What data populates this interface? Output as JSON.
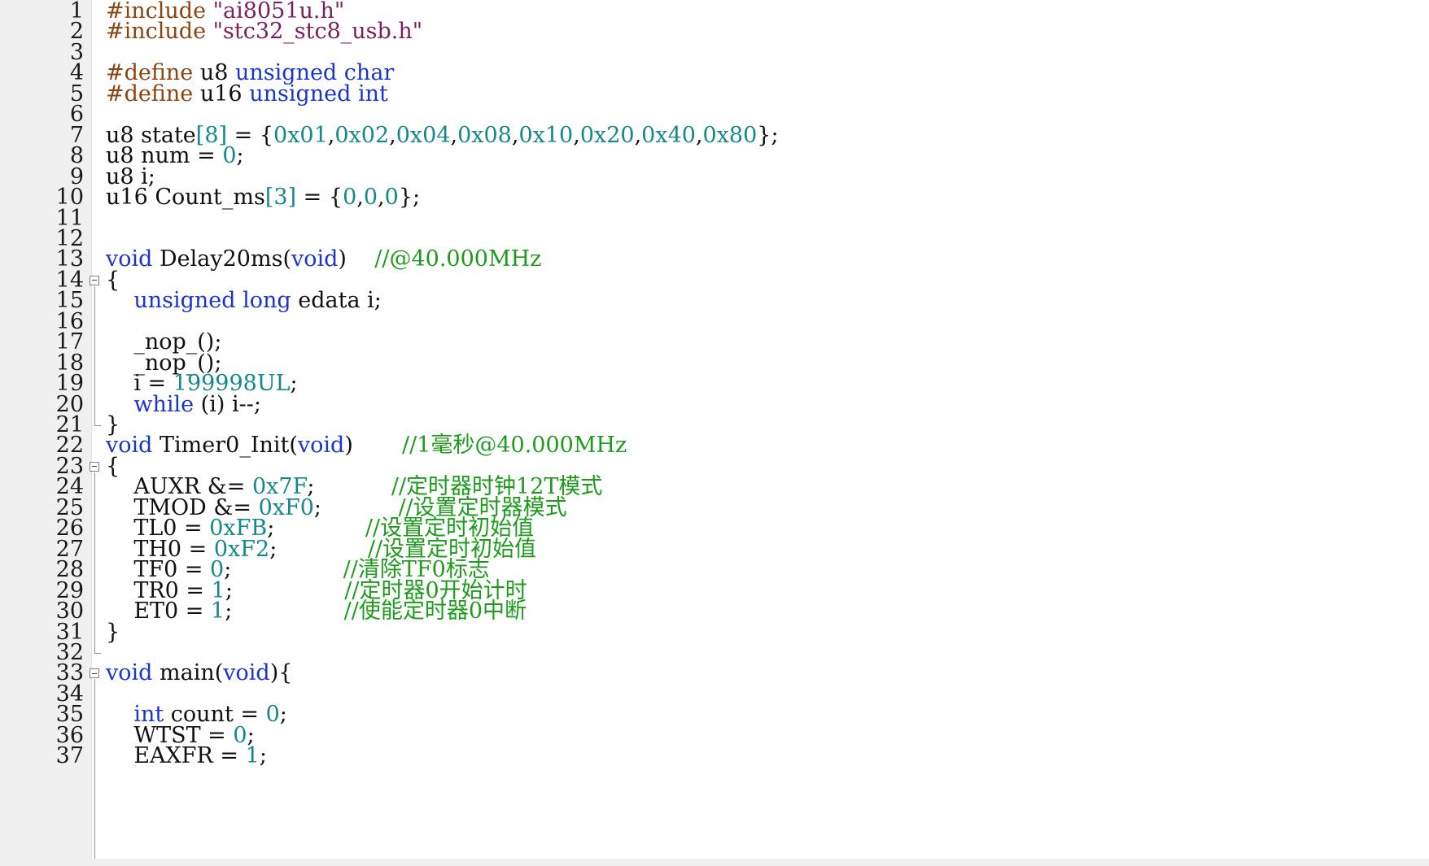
{
  "editor": {
    "colors": {
      "preprocessor": "#8b4513",
      "string": "#7a1f5a",
      "keyword": "#1d34c9",
      "number": "#16888a",
      "comment": "#1f9a1f",
      "text": "#111111",
      "gutter": "#f0f0f0"
    },
    "lines": [
      {
        "n": "1",
        "fold": "",
        "tokens": [
          {
            "t": "#include ",
            "c": "p"
          },
          {
            "t": "\"ai8051u.h\"",
            "c": "s"
          }
        ]
      },
      {
        "n": "2",
        "fold": "",
        "tokens": [
          {
            "t": "#include ",
            "c": "p"
          },
          {
            "t": "\"stc32_stc8_usb.h\"",
            "c": "s"
          }
        ]
      },
      {
        "n": "3",
        "fold": "",
        "tokens": []
      },
      {
        "n": "4",
        "fold": "",
        "tokens": [
          {
            "t": "#define ",
            "c": "p"
          },
          {
            "t": "u8 ",
            "c": "t"
          },
          {
            "t": "unsigned char",
            "c": "k"
          }
        ]
      },
      {
        "n": "5",
        "fold": "",
        "tokens": [
          {
            "t": "#define ",
            "c": "p"
          },
          {
            "t": "u16 ",
            "c": "t"
          },
          {
            "t": "unsigned int",
            "c": "k"
          }
        ]
      },
      {
        "n": "6",
        "fold": "",
        "tokens": []
      },
      {
        "n": "7",
        "fold": "",
        "tokens": [
          {
            "t": "u8 state",
            "c": "t"
          },
          {
            "t": "[8]",
            "c": "n"
          },
          {
            "t": " = {",
            "c": "t"
          },
          {
            "t": "0x01",
            "c": "n"
          },
          {
            "t": ",",
            "c": "t"
          },
          {
            "t": "0x02",
            "c": "n"
          },
          {
            "t": ",",
            "c": "t"
          },
          {
            "t": "0x04",
            "c": "n"
          },
          {
            "t": ",",
            "c": "t"
          },
          {
            "t": "0x08",
            "c": "n"
          },
          {
            "t": ",",
            "c": "t"
          },
          {
            "t": "0x10",
            "c": "n"
          },
          {
            "t": ",",
            "c": "t"
          },
          {
            "t": "0x20",
            "c": "n"
          },
          {
            "t": ",",
            "c": "t"
          },
          {
            "t": "0x40",
            "c": "n"
          },
          {
            "t": ",",
            "c": "t"
          },
          {
            "t": "0x80",
            "c": "n"
          },
          {
            "t": "};",
            "c": "t"
          }
        ]
      },
      {
        "n": "8",
        "fold": "",
        "tokens": [
          {
            "t": "u8 num = ",
            "c": "t"
          },
          {
            "t": "0",
            "c": "n"
          },
          {
            "t": ";",
            "c": "t"
          }
        ]
      },
      {
        "n": "9",
        "fold": "",
        "tokens": [
          {
            "t": "u8 i;",
            "c": "t"
          }
        ]
      },
      {
        "n": "10",
        "fold": "",
        "tokens": [
          {
            "t": "u16 Count_ms",
            "c": "t"
          },
          {
            "t": "[3]",
            "c": "n"
          },
          {
            "t": " = {",
            "c": "t"
          },
          {
            "t": "0",
            "c": "n"
          },
          {
            "t": ",",
            "c": "t"
          },
          {
            "t": "0",
            "c": "n"
          },
          {
            "t": ",",
            "c": "t"
          },
          {
            "t": "0",
            "c": "n"
          },
          {
            "t": "};",
            "c": "t"
          }
        ]
      },
      {
        "n": "11",
        "fold": "",
        "tokens": []
      },
      {
        "n": "12",
        "fold": "",
        "tokens": []
      },
      {
        "n": "13",
        "fold": "",
        "tokens": [
          {
            "t": "void",
            "c": "k"
          },
          {
            "t": " Delay20ms(",
            "c": "t"
          },
          {
            "t": "void",
            "c": "k"
          },
          {
            "t": ")    ",
            "c": "t"
          },
          {
            "t": "//@40.000MHz",
            "c": "c"
          }
        ]
      },
      {
        "n": "14",
        "fold": "open",
        "tokens": [
          {
            "t": "{",
            "c": "t"
          }
        ]
      },
      {
        "n": "15",
        "fold": "",
        "tokens": [
          {
            "t": "    ",
            "c": "t"
          },
          {
            "t": "unsigned long",
            "c": "k"
          },
          {
            "t": " edata i;",
            "c": "t"
          }
        ]
      },
      {
        "n": "16",
        "fold": "",
        "tokens": []
      },
      {
        "n": "17",
        "fold": "",
        "tokens": [
          {
            "t": "    _nop_();",
            "c": "t"
          }
        ]
      },
      {
        "n": "18",
        "fold": "",
        "tokens": [
          {
            "t": "    _nop_();",
            "c": "t"
          }
        ]
      },
      {
        "n": "19",
        "fold": "",
        "tokens": [
          {
            "t": "    i = ",
            "c": "t"
          },
          {
            "t": "199998UL",
            "c": "n"
          },
          {
            "t": ";",
            "c": "t"
          }
        ]
      },
      {
        "n": "20",
        "fold": "",
        "tokens": [
          {
            "t": "    ",
            "c": "t"
          },
          {
            "t": "while",
            "c": "k"
          },
          {
            "t": " (i) i--;",
            "c": "t"
          }
        ]
      },
      {
        "n": "21",
        "fold": "end",
        "tokens": [
          {
            "t": "}",
            "c": "t"
          }
        ]
      },
      {
        "n": "22",
        "fold": "",
        "tokens": [
          {
            "t": "void",
            "c": "k"
          },
          {
            "t": " Timer0_Init(",
            "c": "t"
          },
          {
            "t": "void",
            "c": "k"
          },
          {
            "t": ")       ",
            "c": "t"
          },
          {
            "t": "//1毫秒@40.000MHz",
            "c": "c"
          }
        ]
      },
      {
        "n": "23",
        "fold": "open",
        "tokens": [
          {
            "t": "{",
            "c": "t"
          }
        ]
      },
      {
        "n": "24",
        "fold": "",
        "tokens": [
          {
            "t": "    AUXR &= ",
            "c": "t"
          },
          {
            "t": "0x7F",
            "c": "n"
          },
          {
            "t": ";           ",
            "c": "t"
          },
          {
            "t": "//定时器时钟12T模式",
            "c": "c"
          }
        ]
      },
      {
        "n": "25",
        "fold": "",
        "tokens": [
          {
            "t": "    TMOD &= ",
            "c": "t"
          },
          {
            "t": "0xF0",
            "c": "n"
          },
          {
            "t": ";           ",
            "c": "t"
          },
          {
            "t": "//设置定时器模式",
            "c": "c"
          }
        ]
      },
      {
        "n": "26",
        "fold": "",
        "tokens": [
          {
            "t": "    TL0 = ",
            "c": "t"
          },
          {
            "t": "0xFB",
            "c": "n"
          },
          {
            "t": ";             ",
            "c": "t"
          },
          {
            "t": "//设置定时初始值",
            "c": "c"
          }
        ]
      },
      {
        "n": "27",
        "fold": "",
        "tokens": [
          {
            "t": "    TH0 = ",
            "c": "t"
          },
          {
            "t": "0xF2",
            "c": "n"
          },
          {
            "t": ";             ",
            "c": "t"
          },
          {
            "t": "//设置定时初始值",
            "c": "c"
          }
        ]
      },
      {
        "n": "28",
        "fold": "",
        "tokens": [
          {
            "t": "    TF0 = ",
            "c": "t"
          },
          {
            "t": "0",
            "c": "n"
          },
          {
            "t": ";                ",
            "c": "t"
          },
          {
            "t": "//清除TF0标志",
            "c": "c"
          }
        ]
      },
      {
        "n": "29",
        "fold": "",
        "tokens": [
          {
            "t": "    TR0 = ",
            "c": "t"
          },
          {
            "t": "1",
            "c": "n"
          },
          {
            "t": ";                ",
            "c": "t"
          },
          {
            "t": "//定时器0开始计时",
            "c": "c"
          }
        ]
      },
      {
        "n": "30",
        "fold": "",
        "tokens": [
          {
            "t": "    ET0 = ",
            "c": "t"
          },
          {
            "t": "1",
            "c": "n"
          },
          {
            "t": ";                ",
            "c": "t"
          },
          {
            "t": "//使能定时器0中断",
            "c": "c"
          }
        ]
      },
      {
        "n": "31",
        "fold": "",
        "tokens": [
          {
            "t": "}",
            "c": "t"
          }
        ]
      },
      {
        "n": "32",
        "fold": "end",
        "tokens": []
      },
      {
        "n": "33",
        "fold": "open",
        "tokens": [
          {
            "t": "void",
            "c": "k"
          },
          {
            "t": " main(",
            "c": "t"
          },
          {
            "t": "void",
            "c": "k"
          },
          {
            "t": "){",
            "c": "t"
          }
        ]
      },
      {
        "n": "34",
        "fold": "",
        "tokens": []
      },
      {
        "n": "35",
        "fold": "",
        "tokens": [
          {
            "t": "    ",
            "c": "t"
          },
          {
            "t": "int",
            "c": "k"
          },
          {
            "t": " count = ",
            "c": "t"
          },
          {
            "t": "0",
            "c": "n"
          },
          {
            "t": ";",
            "c": "t"
          }
        ]
      },
      {
        "n": "36",
        "fold": "",
        "tokens": [
          {
            "t": "    WTST = ",
            "c": "t"
          },
          {
            "t": "0",
            "c": "n"
          },
          {
            "t": ";",
            "c": "t"
          }
        ]
      },
      {
        "n": "37",
        "fold": "",
        "tokens": [
          {
            "t": "    EAXFR = ",
            "c": "t"
          },
          {
            "t": "1",
            "c": "n"
          },
          {
            "t": ";",
            "c": "t"
          }
        ]
      }
    ]
  }
}
